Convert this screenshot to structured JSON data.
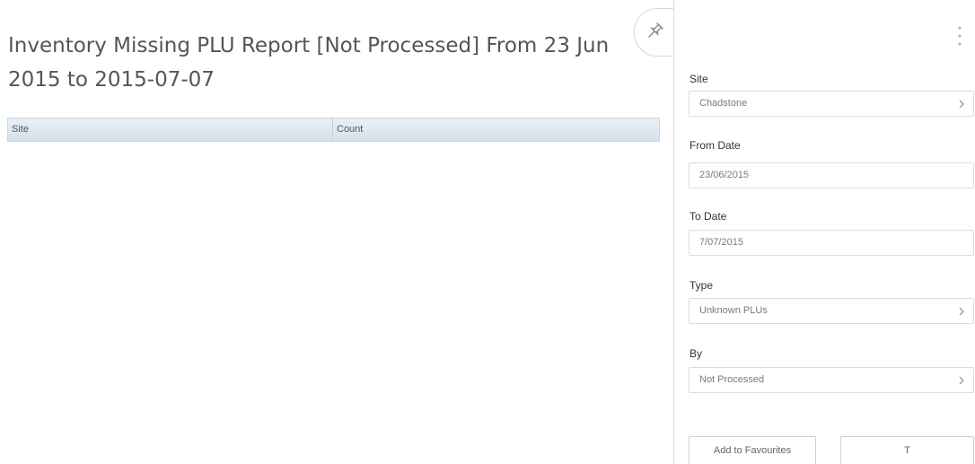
{
  "report": {
    "title": "Inventory Missing PLU Report [Not Processed] From 23 Jun 2015 to 2015-07-07",
    "columns": [
      "Site",
      "Count"
    ],
    "rows": []
  },
  "panel": {
    "pin_icon": "pin-icon",
    "menu_icon": "more-vertical-icon",
    "fields": {
      "site": {
        "label": "Site",
        "value": "Chadstone",
        "icon": "chevron-right-icon"
      },
      "from_date": {
        "label": "From Date",
        "value": "23/06/2015"
      },
      "to_date": {
        "label": "To Date",
        "value": "7/07/2015"
      },
      "type": {
        "label": "Type",
        "value": "Unknown PLUs",
        "icon": "chevron-right-icon"
      },
      "by": {
        "label": "By",
        "value": "Not Processed",
        "icon": "chevron-right-icon"
      }
    },
    "buttons": {
      "add_favourites": "Add to Favourites",
      "t": "T"
    }
  },
  "colors": {
    "table_header_top": "#e9eff6",
    "table_header_bottom": "#d6e1ec",
    "border": "#dcdcdc"
  }
}
